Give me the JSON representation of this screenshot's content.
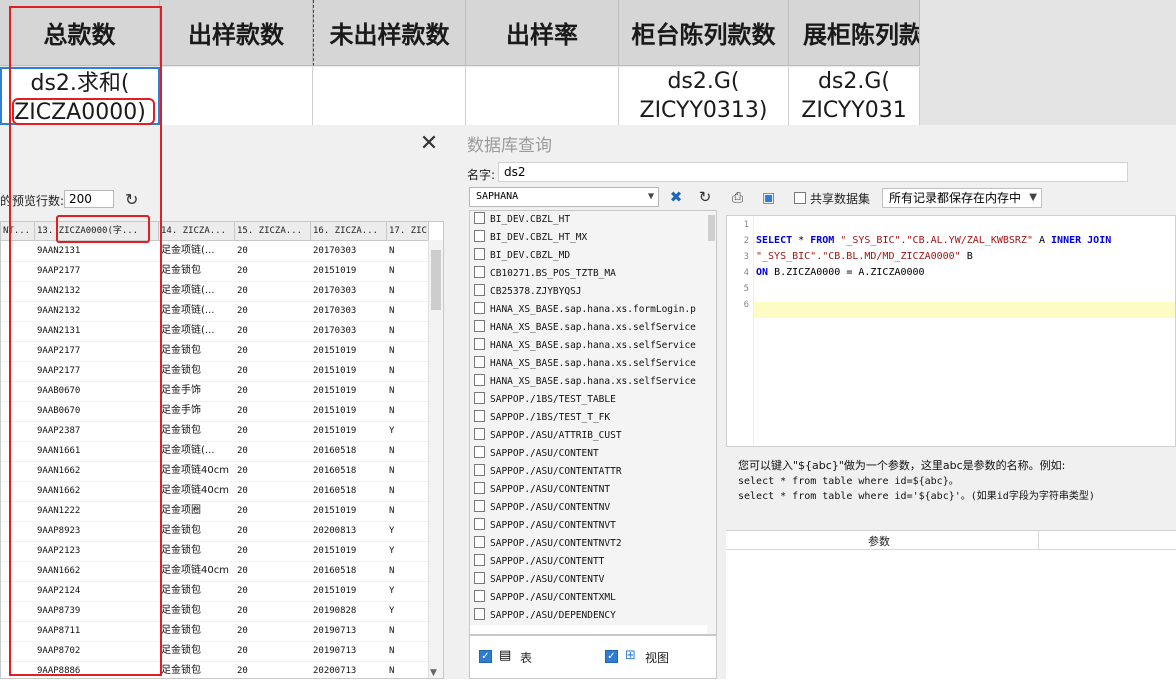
{
  "sheet": {
    "headers": [
      "总款数",
      "出样款数",
      "未出样款数",
      "出样率",
      "柜台陈列款数",
      "展柜陈列款"
    ],
    "cells": [
      {
        "line1": "ds2.求和(",
        "line2": "ZICZA0000)"
      },
      {
        "line1": "",
        "line2": ""
      },
      {
        "line1": "",
        "line2": ""
      },
      {
        "line1": "",
        "line2": ""
      },
      {
        "line1": "ds2.G(",
        "line2": "ZICYY0313)"
      },
      {
        "line1": "ds2.G(",
        "line2": "ZICYY031"
      }
    ]
  },
  "preview": {
    "close_symbol": "✕",
    "rows_label": "的预览行数:",
    "rows_value": "200",
    "refresh_symbol": "↻",
    "columns": [
      "NT...",
      "13. ZICZA0000(字...",
      "14. ZICZA...",
      "15. ZICZA...",
      "16. ZICZA...",
      "17. ZIC"
    ],
    "rows": [
      [
        "9AAN2131",
        "足金项链(...",
        "20",
        "20170303",
        "N"
      ],
      [
        "9AAP2177",
        "足金锁包",
        "20",
        "20151019",
        "N"
      ],
      [
        "9AAN2132",
        "足金项链(...",
        "20",
        "20170303",
        "N"
      ],
      [
        "9AAN2132",
        "足金项链(...",
        "20",
        "20170303",
        "N"
      ],
      [
        "9AAN2131",
        "足金项链(...",
        "20",
        "20170303",
        "N"
      ],
      [
        "9AAP2177",
        "足金锁包",
        "20",
        "20151019",
        "N"
      ],
      [
        "9AAP2177",
        "足金锁包",
        "20",
        "20151019",
        "N"
      ],
      [
        "9AAB0670",
        "足金手饰",
        "20",
        "20151019",
        "N"
      ],
      [
        "9AAB0670",
        "足金手饰",
        "20",
        "20151019",
        "N"
      ],
      [
        "9AAP2387",
        "足金锁包",
        "20",
        "20151019",
        "Y"
      ],
      [
        "9AAN1661",
        "足金项链(...",
        "20",
        "20160518",
        "N"
      ],
      [
        "9AAN1662",
        "足金项链40cm",
        "20",
        "20160518",
        "N"
      ],
      [
        "9AAN1662",
        "足金项链40cm",
        "20",
        "20160518",
        "N"
      ],
      [
        "9AAN1222",
        "足金项圈",
        "20",
        "20151019",
        "N"
      ],
      [
        "9AAP8923",
        "足金锁包",
        "20",
        "20200813",
        "Y"
      ],
      [
        "9AAP2123",
        "足金锁包",
        "20",
        "20151019",
        "Y"
      ],
      [
        "9AAN1662",
        "足金项链40cm",
        "20",
        "20160518",
        "N"
      ],
      [
        "9AAP2124",
        "足金锁包",
        "20",
        "20151019",
        "Y"
      ],
      [
        "9AAP8739",
        "足金锁包",
        "20",
        "20190828",
        "Y"
      ],
      [
        "9AAP8711",
        "足金锁包",
        "20",
        "20190713",
        "N"
      ],
      [
        "9AAP8702",
        "足金锁包",
        "20",
        "20190713",
        "N"
      ],
      [
        "9AAP8886",
        "足金锁包",
        "20",
        "20200713",
        "N"
      ]
    ]
  },
  "dbquery": {
    "title": "数据库查询",
    "name_label": "名字:",
    "name_value": "ds2",
    "database": "SAPHANA",
    "tables": [
      "BI_DEV.CBZL_HT",
      "BI_DEV.CBZL_HT_MX",
      "BI_DEV.CBZL_MD",
      "CB10271.BS_POS_TZTB_MA",
      "CB25378.ZJYBYQSJ",
      "HANA_XS_BASE.sap.hana.xs.formLogin.p",
      "HANA_XS_BASE.sap.hana.xs.selfService",
      "HANA_XS_BASE.sap.hana.xs.selfService",
      "HANA_XS_BASE.sap.hana.xs.selfService",
      "HANA_XS_BASE.sap.hana.xs.selfService",
      "SAPPOP./1BS/TEST_TABLE",
      "SAPPOP./1BS/TEST_T_FK",
      "SAPPOP./ASU/ATTRIB_CUST",
      "SAPPOP./ASU/CONTENT",
      "SAPPOP./ASU/CONTENTATTR",
      "SAPPOP./ASU/CONTENTNT",
      "SAPPOP./ASU/CONTENTNV",
      "SAPPOP./ASU/CONTENTNVT",
      "SAPPOP./ASU/CONTENTNVT2",
      "SAPPOP./ASU/CONTENTT",
      "SAPPOP./ASU/CONTENTV",
      "SAPPOP./ASU/CONTENTXML",
      "SAPPOP./ASU/DEPENDENCY"
    ],
    "filter_table_label": "表",
    "filter_view_label": "视图",
    "share_label": "共享数据集",
    "memory_option": "所有记录都保存在内存中",
    "sql": {
      "line_numbers": [
        "1",
        "2",
        "3",
        "4",
        "5",
        "6"
      ],
      "select_kw": "SELECT",
      "star": " * ",
      "from_kw": "FROM",
      "table1": " \"_SYS_BIC\".\"CB.AL.YW/ZAL_KWBSRZ\"",
      "alias_a": " A ",
      "join_kw": "INNER JOIN",
      "table2": "\"_SYS_BIC\".\"CB.BL.MD/MD_ZICZA0000\"",
      "alias_b": " B",
      "on_kw": "ON",
      "condition": " B.ZICZA0000 = A.ZICZA0000"
    },
    "help_lines": [
      "您可以键入\"${abc}\"做为一个参数，这里abc是参数的名称。例如:",
      "select * from table where id=${abc}。",
      "select * from table where id='${abc}'。(如果id字段为字符串类型)"
    ],
    "param_header": "参数"
  }
}
